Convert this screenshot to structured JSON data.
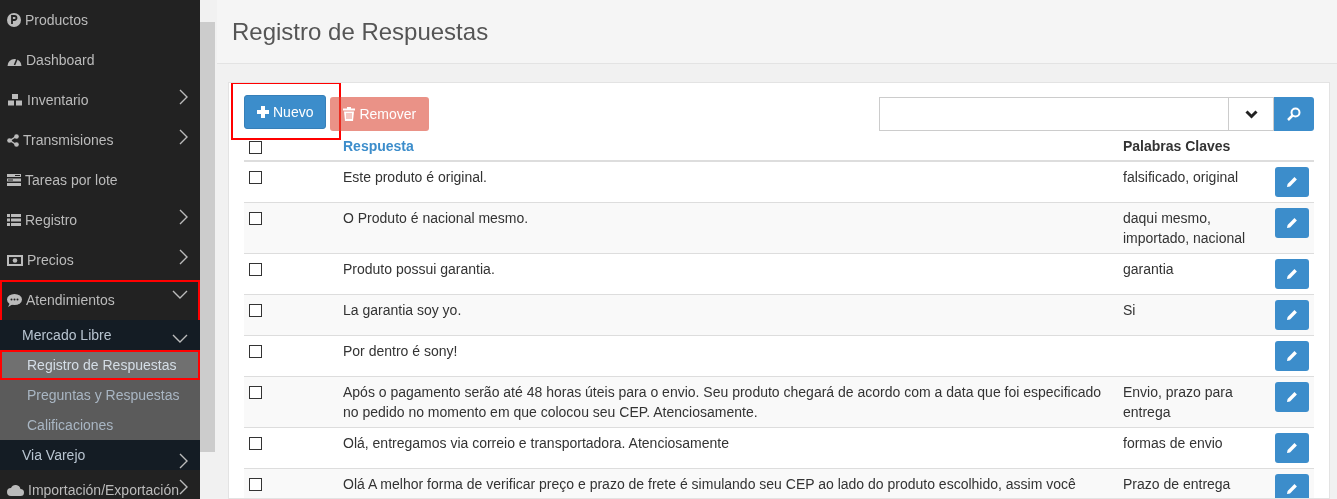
{
  "sidebar": {
    "items": [
      {
        "label": "Productos"
      },
      {
        "label": "Dashboard"
      },
      {
        "label": "Inventario",
        "expanded": false
      },
      {
        "label": "Transmisiones",
        "expanded": false
      },
      {
        "label": "Tareas por lote"
      },
      {
        "label": "Registro",
        "expanded": false
      },
      {
        "label": "Precios",
        "expanded": false
      },
      {
        "label": "Atendimientos",
        "expanded": true,
        "highlighted": true,
        "children": [
          {
            "label": "Mercado Libre",
            "expanded": true,
            "children": [
              {
                "label": "Registro de Respuestas",
                "selected": true,
                "highlighted": true
              },
              {
                "label": "Preguntas y Respuestas",
                "selected": false,
                "highlighted": false
              },
              {
                "label": "Calificaciones",
                "selected": false,
                "highlighted": false
              }
            ]
          },
          {
            "label": "Via Varejo",
            "expanded": false
          }
        ]
      },
      {
        "label": "Importación/Exportación",
        "expanded": false
      }
    ]
  },
  "page_title": "Registro de Respuestas",
  "toolbar": {
    "new_button": {
      "label": "Nuevo",
      "highlighted": true
    },
    "remove_button": {
      "label": "Remover",
      "disabled": true
    }
  },
  "table": {
    "select_all_checked": false,
    "columns": [
      "Respuesta",
      "Palabras Claves"
    ],
    "rows": [
      {
        "checked": false,
        "respuesta": "Este produto é original.",
        "palabras_claves": "falsificado, original"
      },
      {
        "checked": false,
        "respuesta": "O Produto é nacional mesmo.",
        "palabras_claves": "daqui mesmo, importado, nacional"
      },
      {
        "checked": false,
        "respuesta": "Produto possui garantia.",
        "palabras_claves": "garantia"
      },
      {
        "checked": false,
        "respuesta": "La garantia soy yo.",
        "palabras_claves": "Si"
      },
      {
        "checked": false,
        "respuesta": "Por dentro é sony!"
      },
      {
        "checked": false,
        "respuesta": "Após o pagamento serão até 48 horas úteis para o envio. Seu produto chegará de acordo com a data que foi especificado no pedido no momento em que colocou seu CEP. Atenciosamente.",
        "palabras_claves": "Envio, prazo para entrega"
      },
      {
        "checked": false,
        "respuesta": "Olá, entregamos via correio e transportadora. Atenciosamente",
        "palabras_claves": "formas de envio"
      },
      {
        "checked": false,
        "respuesta": "Olá A melhor forma de verificar preço e prazo de frete é simulando seu CEP ao lado do produto escolhido, assim você",
        "palabras_claves": "Prazo de entrega"
      }
    ]
  }
}
